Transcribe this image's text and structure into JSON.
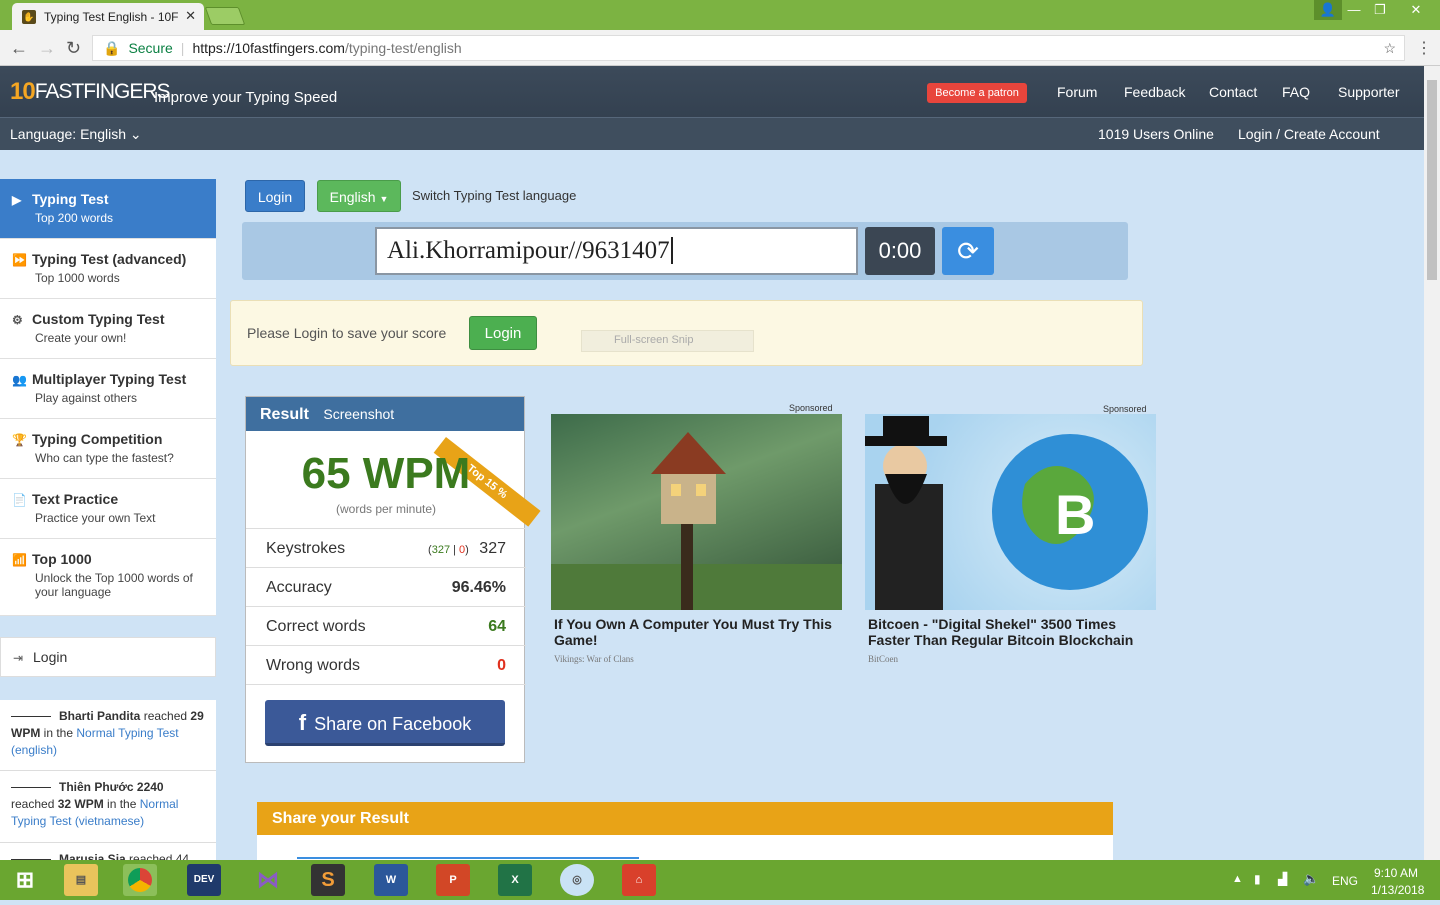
{
  "browser": {
    "tab_title": "Typing Test English - 10F",
    "secure_label": "Secure",
    "url_host": "https://10fastfingers.com",
    "url_path": "/typing-test/english"
  },
  "header": {
    "logo_ten": "10",
    "logo_text": "FASTFINGERS",
    "tagline": "Improve your Typing Speed",
    "patron_label": "Become a patron",
    "nav": [
      "Forum",
      "Feedback",
      "Contact",
      "FAQ",
      "Supporter"
    ],
    "language_label": "Language: English",
    "users_online": "1019 Users Online",
    "login_create": "Login / Create Account"
  },
  "sidebar": {
    "items": [
      {
        "title": "Typing Test",
        "sub": "Top 200 words",
        "icon": "play-icon",
        "glyph": "▶"
      },
      {
        "title": "Typing Test (advanced)",
        "sub": "Top 1000 words",
        "icon": "fast-forward-icon",
        "glyph": "⏩"
      },
      {
        "title": "Custom Typing Test",
        "sub": "Create your own!",
        "icon": "gears-icon",
        "glyph": "⚙"
      },
      {
        "title": "Multiplayer Typing Test",
        "sub": "Play against others",
        "icon": "users-icon",
        "glyph": "👥"
      },
      {
        "title": "Typing Competition",
        "sub": "Who can type the fastest?",
        "icon": "trophy-icon",
        "glyph": "🏆"
      },
      {
        "title": "Text Practice",
        "sub": "Practice your own Text",
        "icon": "document-icon",
        "glyph": "📄"
      },
      {
        "title": "Top 1000",
        "sub": "Unlock the Top 1000 words of your language",
        "icon": "signal-icon",
        "glyph": "📶"
      }
    ],
    "login_label": "Login",
    "feed": [
      {
        "name": "Bharti Pandita",
        "text1": " reached ",
        "wpm": "29 WPM",
        "text2": " in the ",
        "link": "Normal Typing Test (english)"
      },
      {
        "name": "Thiên Phước 2240",
        "text1": " reached ",
        "wpm": "32 WPM",
        "text2": " in the ",
        "link": "Normal Typing Test (vietnamese)"
      },
      {
        "name": "Marusia Sia",
        "text1": " reached 44",
        "wpm": "",
        "text2": "",
        "link": ""
      }
    ]
  },
  "controls": {
    "login_button": "Login",
    "language_button": "English",
    "switch_label": "Switch Typing Test language",
    "input_value": "Ali.Khorramipour//9631407",
    "timer": "0:00"
  },
  "notice": {
    "text": "Please Login to save your score",
    "login_button": "Login",
    "snip_label": "Full-screen Snip"
  },
  "result": {
    "title": "Result",
    "screenshot_label": "Screenshot",
    "ribbon": "Top 15 %",
    "wpm": "65 WPM",
    "wpm_caption": "(words per minute)",
    "keystrokes_label": "Keystrokes",
    "keystrokes_correct": "327",
    "keystrokes_wrong": "0",
    "keystrokes_total": "327",
    "accuracy_label": "Accuracy",
    "accuracy": "96.46%",
    "correct_label": "Correct words",
    "correct": "64",
    "wrong_label": "Wrong words",
    "wrong": "0",
    "share_label": "Share on Facebook"
  },
  "ads": [
    {
      "sponsored": "Sponsored",
      "title": "If You Own A Computer You Must Try This Game!",
      "source": "Vikings: War of Clans"
    },
    {
      "sponsored": "Sponsored",
      "title": "Bitcoen - \"Digital Shekel\" 3500 Times Faster Than Regular Bitcoin Blockchain",
      "source": "BitCoen"
    }
  ],
  "share_section": {
    "title": "Share your Result"
  },
  "taskbar": {
    "lang": "ENG",
    "time": "9:10 AM",
    "date": "1/13/2018"
  },
  "colors": {
    "accent": "#3a7dc9",
    "header": "#2e3b4a",
    "success": "#4caf50",
    "danger": "#e0301e",
    "wpm_green": "#3b7a1e",
    "share_orange": "#e8a317"
  }
}
